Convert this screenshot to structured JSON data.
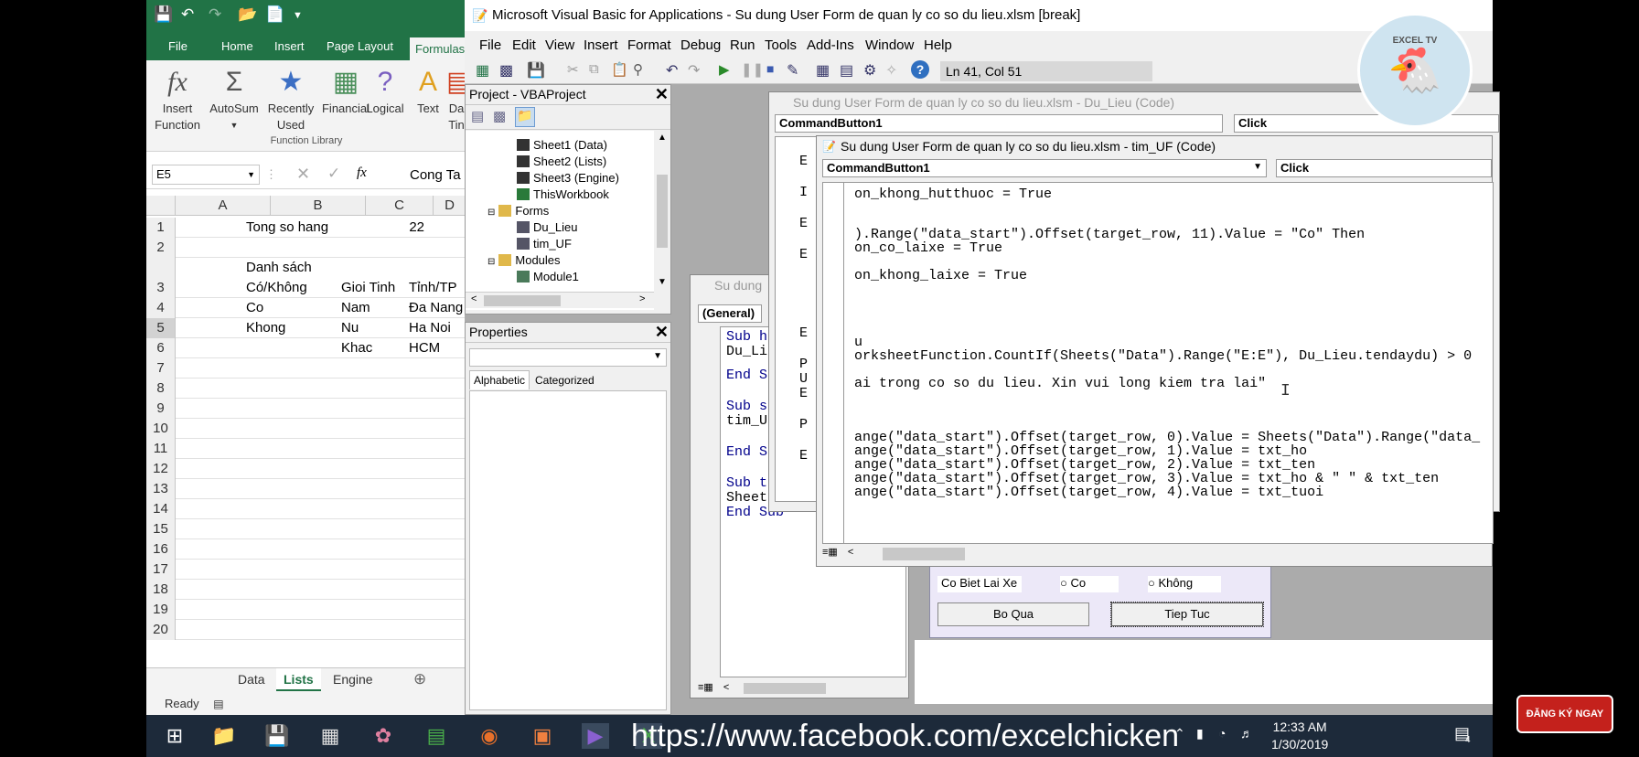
{
  "excel": {
    "qat_icons": [
      "save-icon",
      "undo-icon",
      "redo-icon",
      "open-icon",
      "new-icon",
      "customize-icon"
    ],
    "tabs": [
      "File",
      "Home",
      "Insert",
      "Page Layout",
      "Formulas"
    ],
    "ribbon": {
      "insert_function": [
        "Insert",
        "Function"
      ],
      "autosum": "AutoSum",
      "recently_used": [
        "Recently",
        "Used"
      ],
      "financial": "Financial",
      "logical": "Logical",
      "text": "Text",
      "date_partial": [
        "Da",
        "Tin"
      ],
      "group_label": "Function Library"
    },
    "name_box": "E5",
    "formula_bar": "Cong Ta",
    "col_headers": [
      "A",
      "B",
      "C",
      "D"
    ],
    "row_numbers": [
      "1",
      "2",
      "3",
      "4",
      "5",
      "6",
      "7",
      "8",
      "9",
      "10",
      "11",
      "12",
      "13",
      "14",
      "15",
      "16",
      "17",
      "18",
      "19",
      "20"
    ],
    "cells": {
      "B1": "Tong so hang",
      "C1": "22",
      "B3a": "Danh sách",
      "B3b": "Có/Không",
      "C3": "Gioi Tinh",
      "D3": "Tỉnh/TP",
      "B4": "Co",
      "C4": "Nam",
      "D4": "Đa Nang",
      "B5": "Khong",
      "C5": "Nu",
      "D5": "Ha Noi",
      "C6": "Khac",
      "D6": "HCM"
    },
    "sheet_tabs": [
      "Data",
      "Lists",
      "Engine"
    ],
    "active_sheet": "Lists",
    "status": "Ready"
  },
  "vba": {
    "title": "Microsoft Visual Basic for Applications - Su dung User Form de quan ly co so du lieu.xlsm [break]",
    "menu": [
      "File",
      "Edit",
      "View",
      "Insert",
      "Format",
      "Debug",
      "Run",
      "Tools",
      "Add-Ins",
      "Window",
      "Help"
    ],
    "cursor_pos": "Ln 41, Col 51",
    "project": {
      "title": "Project - VBAProject",
      "items": [
        {
          "label": "Sheet1 (Data)",
          "icon": "sheet-icon"
        },
        {
          "label": "Sheet2 (Lists)",
          "icon": "sheet-icon"
        },
        {
          "label": "Sheet3 (Engine)",
          "icon": "sheet-icon"
        },
        {
          "label": "ThisWorkbook",
          "icon": "workbook-icon"
        },
        {
          "label": "Forms",
          "icon": "folder-icon"
        },
        {
          "label": "Du_Lieu",
          "icon": "form-icon"
        },
        {
          "label": "tim_UF",
          "icon": "form-icon"
        },
        {
          "label": "Modules",
          "icon": "folder-icon"
        },
        {
          "label": "Module1",
          "icon": "module-icon"
        }
      ]
    },
    "properties": {
      "title": "Properties",
      "tabs": [
        "Alphabetic",
        "Categorized"
      ]
    },
    "module_window": {
      "title": "Su dung",
      "proc_combo": "(General)",
      "lines": [
        "Sub h",
        "Du_Li",
        "End S",
        "Sub s",
        "tim_U",
        "End S",
        "Sub t",
        "Sheet",
        "End Sub"
      ]
    },
    "du_lieu_window": {
      "title": "Su dung User Form de quan ly co so du lieu.xlsm - Du_Lieu (Code)",
      "object_combo": "CommandButton1",
      "proc_combo": "Click",
      "margin_letters": [
        "E",
        "I",
        "E",
        "E",
        "E",
        "P",
        "U",
        "E",
        "P",
        "E"
      ]
    },
    "tim_uf_window": {
      "title": "Su dung User Form de quan ly co so du lieu.xlsm - tim_UF (Code)",
      "object_combo": "CommandButton1",
      "proc_combo": "Click",
      "code_lines": [
        "on_khong_hutthuoc = True",
        ").Range(\"data_start\").Offset(target_row, 11).Value = \"Co\" Then",
        "on_co_laixe = True",
        "on_khong_laixe = True",
        "u",
        "orksheetFunction.CountIf(Sheets(\"Data\").Range(\"E:E\"), Du_Lieu.tendaydu) > 0",
        "ai trong co so du lieu. Xin vui long kiem tra lai\"",
        "ange(\"data_start\").Offset(target_row, 0).Value = Sheets(\"Data\").Range(\"data_",
        "ange(\"data_start\").Offset(target_row, 1).Value = txt_ho",
        "ange(\"data_start\").Offset(target_row, 2).Value = txt_ten",
        "ange(\"data_start\").Offset(target_row, 3).Value = txt_ho & \" \" & txt_ten",
        "ange(\"data_start\").Offset(target_row, 4).Value = txt_tuoi"
      ]
    },
    "userform": {
      "label": "Co Biet Lai Xe",
      "opt_yes": "Co",
      "opt_no": "Không",
      "btn_skip": "Bo Qua",
      "btn_next": "Tiep Tuc"
    }
  },
  "taskbar": {
    "url": "https://www.facebook.com/excelchicken",
    "time": "12:33 AM",
    "date": "1/30/2019",
    "notifications": "4"
  },
  "overlay": {
    "logo": "EXCEL TV",
    "subscribe": "ĐĂNG KÝ NGAY"
  }
}
